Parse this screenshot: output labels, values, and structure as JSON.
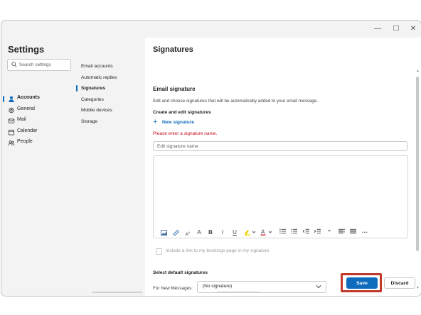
{
  "window": {
    "controls": {
      "minimize": "—",
      "maximize": "☐",
      "close": "✕"
    }
  },
  "sidebar": {
    "title": "Settings",
    "search_placeholder": "Search settings",
    "items": [
      {
        "label": "Accounts",
        "icon": "person-icon",
        "active": true
      },
      {
        "label": "General",
        "icon": "gear-icon"
      },
      {
        "label": "Mail",
        "icon": "mail-icon"
      },
      {
        "label": "Calendar",
        "icon": "calendar-icon"
      },
      {
        "label": "People",
        "icon": "people-icon"
      }
    ]
  },
  "subnav": {
    "items": [
      {
        "label": "Email accounts"
      },
      {
        "label": "Automatic replies"
      },
      {
        "label": "Signatures",
        "active": true
      },
      {
        "label": "Categories"
      },
      {
        "label": "Mobile devices"
      },
      {
        "label": "Storage"
      }
    ]
  },
  "panel": {
    "title": "Signatures",
    "section_title": "Email signature",
    "description": "Edit and choose signatures that will be automatically added to your email message.",
    "create_title": "Create and edit signatures",
    "new_signature": "New signature",
    "error": "Please enter a signature name.",
    "name_placeholder": "Edit signature name",
    "bookings_checkbox": "Include a link to my bookings page in my signature",
    "default_title": "Select default signatures",
    "for_new_label": "For New Messages:",
    "for_new_value": "(No signature)"
  },
  "toolbar": {
    "bold": "B",
    "italic": "I",
    "underline": "U",
    "font_color": "A",
    "font_size": "A",
    "quote": "”",
    "more": "···"
  },
  "footer": {
    "save": "Save",
    "discard": "Discard"
  },
  "colors": {
    "accent": "#0f6cbd",
    "error": "#c50f1f",
    "highlight_box": "#c0392b"
  }
}
